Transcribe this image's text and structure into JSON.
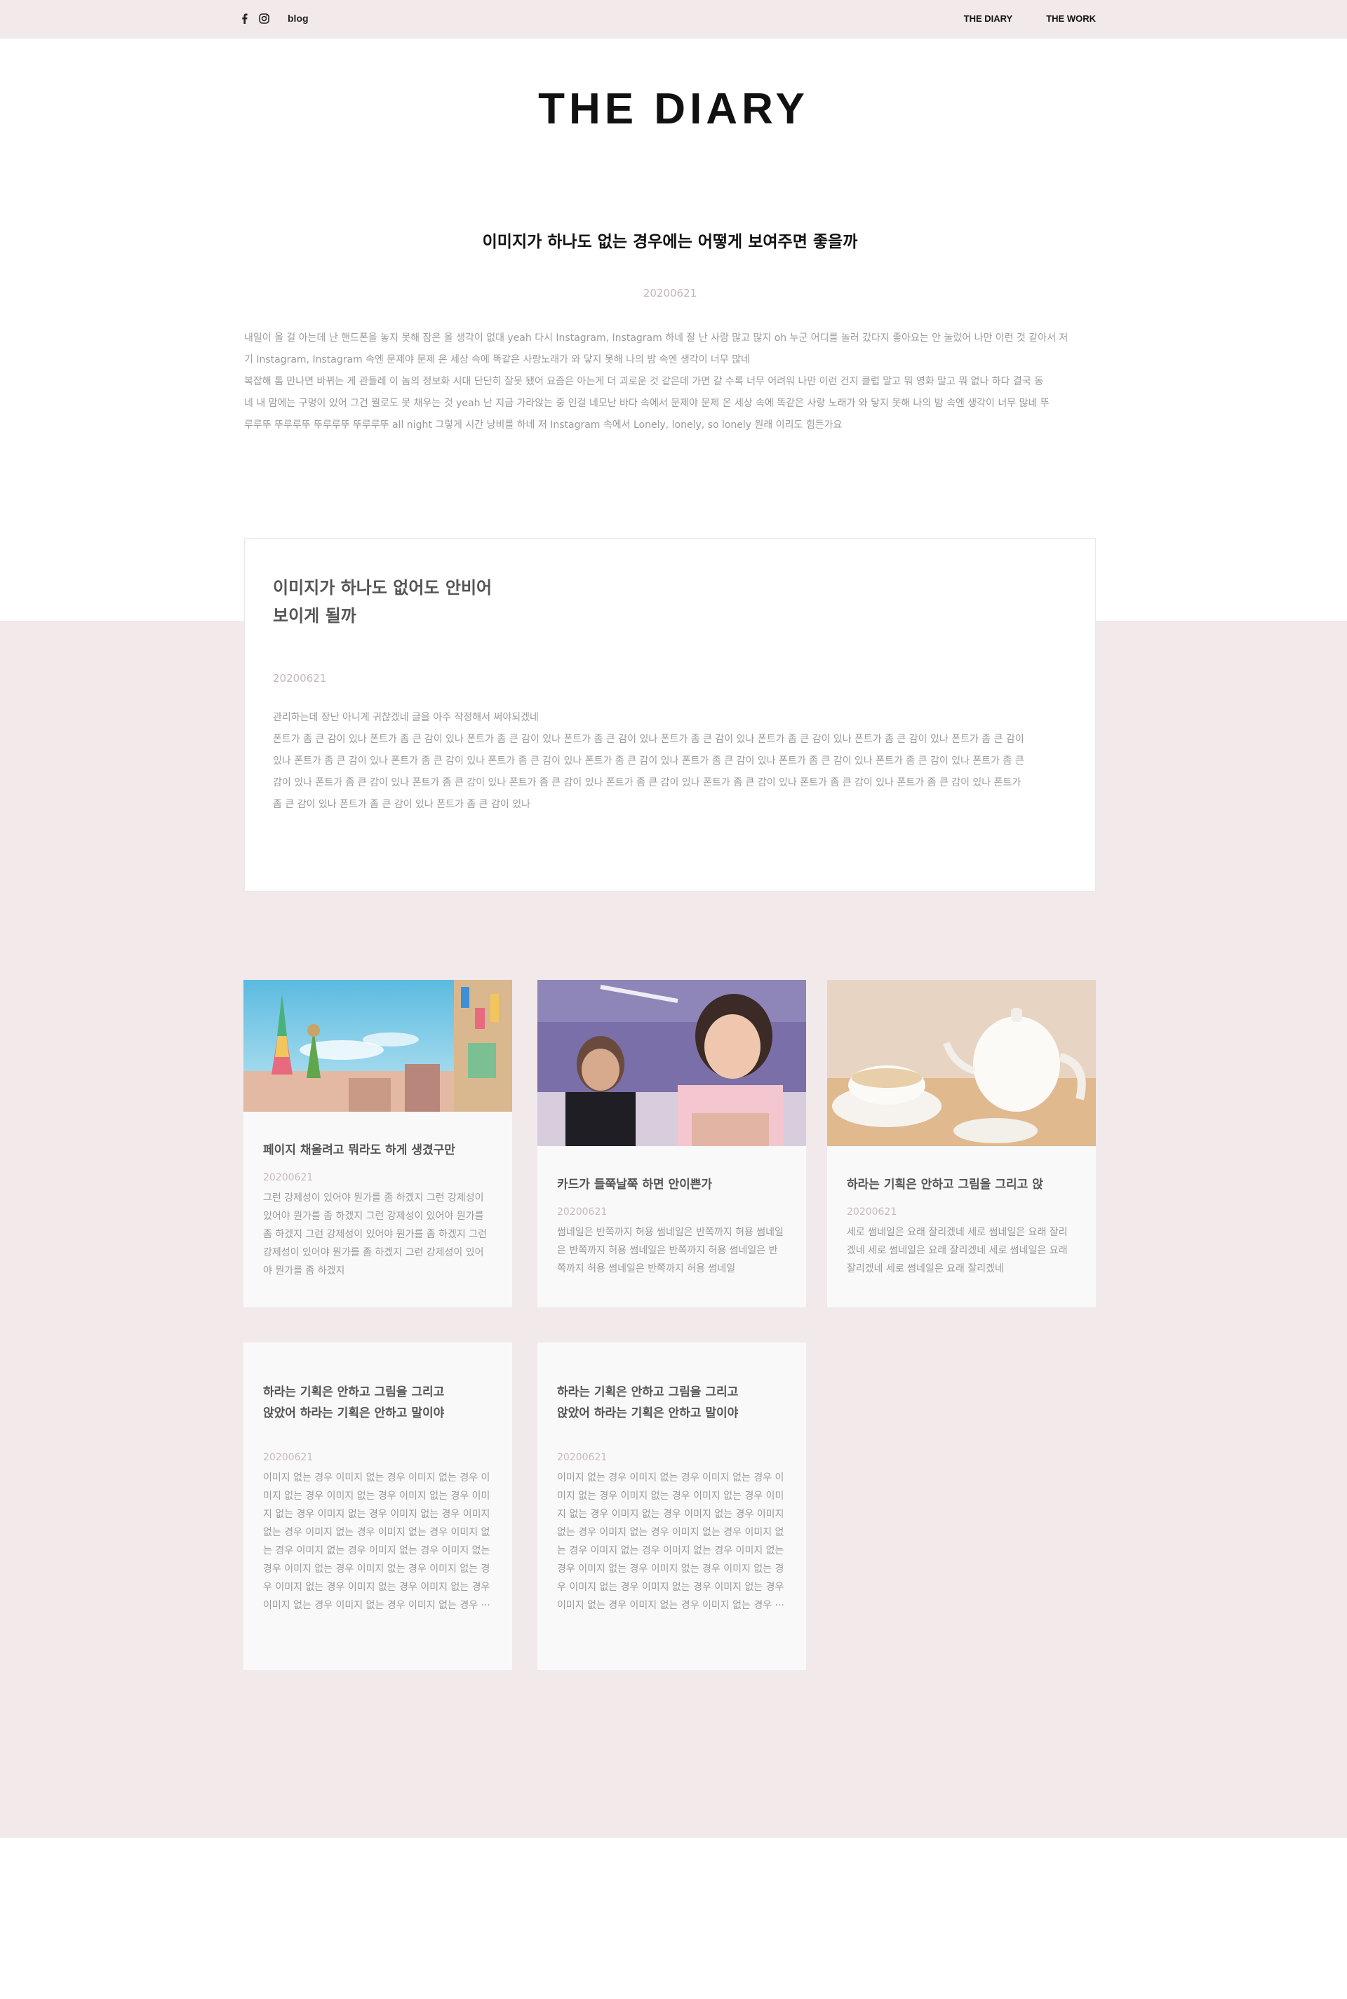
{
  "topbar": {
    "icons": [
      "facebook-icon",
      "instagram-icon"
    ],
    "blog_label": "blog",
    "nav": [
      "THE DIARY",
      "THE WORK"
    ]
  },
  "page_title": "THE DIARY",
  "post_main": {
    "title": "이미지가 하나도 없는 경우에는 어떻게 보여주면 좋을까",
    "date": "20200621",
    "body_lines": [
      "내일이 올 걸 아는데 난 핸드폰을 놓지 못해 잠은 올 생각이 없대 yeah 다시 Instagram, Instagram 하네 잘 난 사람 많고 많지 oh 누군 어디를 놀러 갔다지 좋아요는 안 눌렀어 나만 이런 것 같아서 저",
      "기 Instagram, Instagram 속엔 문제야 문제 온 세상 속에 똑같은 사랑노래가 와 닿지 못해 나의 밤 속엔 생각이 너무 많네",
      "복잡해 톰 만나면 바뀌는 게 관들레 이 놈의 정보화 시대 단단히 잘못 됐어 요즘은 아는게 더 괴로운 것 같은데 가면 갈 수록 너무 어려워 나만 이런 건지 클럽 말고 뭐 영화 말고 뭐 없나 하다 결국 동",
      "네 내 맘에는 구멍이 있어 그건 뭘로도 못 채우는 것 yeah 난 지금 가라앉는 중 인걸 네모난 바다 속에서 문제야 문제 온 세상 속에 똑같은 사랑 노래가 와 닿지 못해 나의 밤 속엔 생각이 너무 많네 뚜",
      "루루뚜 뚜루루뚜 뚜루루뚜 뚜루루뚜 all night 그렇게 시간 낭비를 하네 저 Instagram 속에서 Lonely, lonely, so lonely 원래 이리도 힘든가요"
    ]
  },
  "post_boxed": {
    "title": "이미지가 하나도 없어도 안비어 보이게 될까",
    "date": "20200621",
    "body_lines": [
      "관리하는데 장난 아니게 귀찮겠네 글을 아주 작정해서 써야되겠네",
      "폰트가 좀 큰 감이 있나 폰트가 좀 큰 감이 있나 폰트가 좀 큰 감이 있나 폰트가 좀 큰 감이 있나 폰트가 좀 큰 감이 있나 폰트가 좀 큰 감이 있나 폰트가 좀 큰 감이 있나 폰트가 좀 큰 감이",
      "있나 폰트가 좀 큰 감이 있나 폰트가 좀 큰 감이 있나 폰트가 좀 큰 감이 있나 폰트가 좀 큰 감이 있나 폰트가 좀 큰 감이 있나 폰트가 좀 큰 감이 있나 폰트가 좀 큰 감이 있나 폰트가 좀 큰",
      "감이 있나 폰트가 좀 큰 감이 있나 폰트가 좀 큰 감이 있나 폰트가 좀 큰 감이 있나 폰트가 좀 큰 감이 있나 폰트가 좀 큰 감이 있나 폰트가 좀 큰 감이 있나 폰트가 좀 큰 감이 있나 폰트가",
      "좀 큰 감이 있나 폰트가 좀 큰 감이 있나 폰트가 좀 큰 감이 있나"
    ]
  },
  "cards": [
    {
      "title": "페이지 채울려고 뭐라도 하게 생겼구만",
      "date": "20200621",
      "body": "그런 강제성이 있어야 뭔가를 좀 하겠지 그런 강제성이 있어야 뭔가를 좀 하겠지 그런 강제성이 있어야 뭔가를 좀 하겠지 그런 강제성이 있어야 뭔가를 좀 하겠지 그런 강제성이 있어야 뭔가를 좀 하겠지 그런 강제성이 있어야 뭔가를 좀 하겠지",
      "image": "colorful-street-photo"
    },
    {
      "title": "카드가 들쭉날쭉 하면 안이쁜가",
      "date": "20200621",
      "body": "썸네일은 반쪽까지 허용 썸네일은 반쪽까지 허용 썸네일은 반쪽까지 허용 썸네일은 반쪽까지 허용 썸네일은 반쪽까지 허용 썸네일은 반쪽까지 허용 썸네일",
      "image": "selfie-photo"
    },
    {
      "title": "하라는 기획은 안하고 그림을 그리고 앉",
      "date": "20200621",
      "body": "세로 썸네일은 요래 잘리겠네 세로 썸네일은 요래 잘리겠네 세로 썸네일은 요래 잘리겠네 세로 썸네일은 요래 잘리겠네 세로 썸네일은 요래 잘리겠네",
      "image": "teapot-photo"
    },
    {
      "title": "하라는 기획은 안하고 그림을 그리고 앉았어 하라는 기획은 안하고 말이야",
      "date": "20200621",
      "body": "이미지 없는 경우 이미지 없는 경우 이미지 없는 경우 이미지 없는 경우 이미지 없는 경우 이미지 없는 경우 이미지 없는 경우 이미지 없는 경우 이미지 없는 경우 이미지 없는 경우 이미지 없는 경우 이미지 없는 경우 이미지 없는 경우 이미지 없는 경우 이미지 없는 경우 이미지 없는 경우 이미지 없는 경우 이미지 없는 경우 이미지 없는 경우 이미지 없는 경우 이미지 없는 경우 이미지 없는 경우 이미지 없는 경우 이미지 없는 경우 이미지 없는 경우 ···"
    },
    {
      "title": "하라는 기획은 안하고 그림을 그리고 앉았어 하라는 기획은 안하고 말이야",
      "date": "20200621",
      "body": "이미지 없는 경우 이미지 없는 경우 이미지 없는 경우 이미지 없는 경우 이미지 없는 경우 이미지 없는 경우 이미지 없는 경우 이미지 없는 경우 이미지 없는 경우 이미지 없는 경우 이미지 없는 경우 이미지 없는 경우 이미지 없는 경우 이미지 없는 경우 이미지 없는 경우 이미지 없는 경우 이미지 없는 경우 이미지 없는 경우 이미지 없는 경우 이미지 없는 경우 이미지 없는 경우 이미지 없는 경우 이미지 없는 경우 이미지 없는 경우 이미지 없는 경우 ···"
    }
  ],
  "colors": {
    "band": "#f2e9ea",
    "card": "#f9f9f9",
    "date": "#c4b6b8",
    "body_text": "#9a9a9a"
  }
}
